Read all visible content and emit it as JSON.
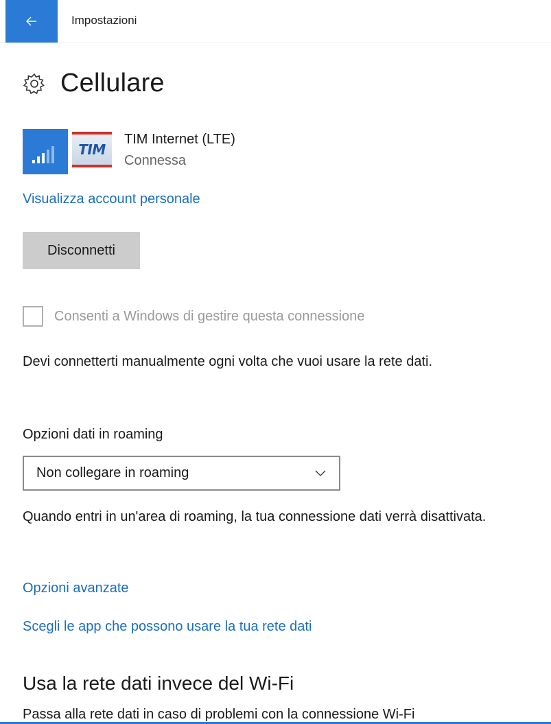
{
  "header": {
    "app_title": "Impostazioni"
  },
  "page": {
    "title": "Cellulare"
  },
  "network": {
    "name": "TIM Internet (LTE)",
    "status": "Connessa",
    "carrier_logo_text": "TIM"
  },
  "links": {
    "view_account": "Visualizza account personale",
    "advanced_options": "Opzioni avanzate",
    "choose_apps": "Scegli le app che possono usare la tua rete dati"
  },
  "buttons": {
    "disconnect": "Disconnetti"
  },
  "checkbox": {
    "label": "Consenti a Windows di gestire questa connessione",
    "checked": false
  },
  "texts": {
    "manual_connect": "Devi connetterti manualmente ogni volta che vuoi usare la rete dati.",
    "roaming_label": "Opzioni dati in roaming",
    "roaming_note": "Quando entri in un'area di roaming, la tua connessione dati verrà disattivata.",
    "wifi_heading": "Usa la rete dati invece del Wi-Fi",
    "wifi_desc_partial": "Passa alla rete dati in caso di problemi con la connessione Wi-Fi"
  },
  "roaming_dropdown": {
    "selected": "Non collegare in roaming"
  },
  "colors": {
    "accent": "#2b7bd6",
    "link": "#1a6fc0",
    "button_bg": "#cccccc",
    "carrier_red": "#d22f27"
  },
  "icons": {
    "back": "back-arrow-icon",
    "settings": "gear-icon",
    "signal": "signal-bars-icon",
    "dropdown": "chevron-down-icon"
  }
}
